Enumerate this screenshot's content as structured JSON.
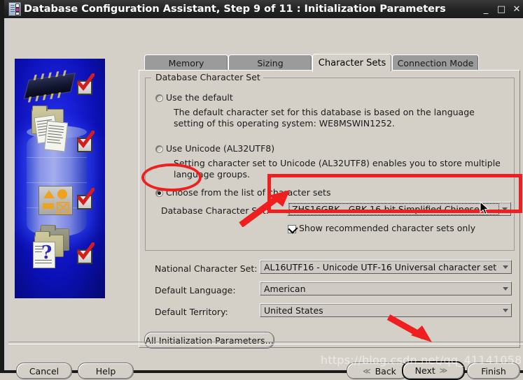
{
  "window": {
    "title": "Database Configuration Assistant, Step 9 of 11 : Initialization Parameters",
    "icon": "database-app-icon",
    "minimize_label": "_",
    "maximize_label": "□",
    "close_label": "✕"
  },
  "tabs": [
    {
      "id": "memory",
      "label": "Memory",
      "active": false
    },
    {
      "id": "sizing",
      "label": "Sizing",
      "active": false
    },
    {
      "id": "character-sets",
      "label": "Character Sets",
      "active": true
    },
    {
      "id": "connection-mode",
      "label": "Connection Mode",
      "active": false
    }
  ],
  "group": {
    "title": "Database Character Set",
    "options": [
      {
        "id": "use-default",
        "label": "Use the default",
        "selected": false,
        "description": "The default character set for this database is based on the language setting of this operating system: WE8MSWIN1252."
      },
      {
        "id": "use-unicode",
        "label": "Use Unicode (AL32UTF8)",
        "selected": false,
        "description": "Setting character set to Unicode (AL32UTF8) enables you to store multiple language groups."
      },
      {
        "id": "choose-from-list",
        "label": "Choose from the list of character sets",
        "selected": true,
        "description": ""
      }
    ],
    "database_charset_label": "Database Character Set:",
    "database_charset_value": "ZHS16GBK - GBK 16-bit Simplified Chinese",
    "show_recommended_label": "Show recommended character sets only",
    "show_recommended_checked": true
  },
  "fields": [
    {
      "id": "national-character-set",
      "label": "National Character Set:",
      "value": "AL16UTF16 - Unicode UTF-16 Universal character set"
    },
    {
      "id": "default-language",
      "label": "Default Language:",
      "value": "American"
    },
    {
      "id": "default-territory",
      "label": "Default Territory:",
      "value": "United States"
    }
  ],
  "buttons": {
    "all_init_params": "All Initialization Parameters...",
    "cancel": "Cancel",
    "help": "Help",
    "back": "Back",
    "next": "Next",
    "finish": "Finish",
    "back_arrow": "≪",
    "next_arrow": "≫"
  },
  "sidebar": {
    "alt": "Oracle Database Configuration Assistant wizard illustration",
    "steps_completed": 4
  },
  "annotations": {
    "ellipse_target": "choose-from-list-radio",
    "rect_target": "database-charset-combo",
    "arrow_to_combo": "red-arrow-up-right",
    "arrow_to_next": "red-arrow-down-right"
  },
  "watermark": {
    "text": "https://blog.csdn.net/qq_41141058"
  },
  "colors": {
    "annotation_red": "#ef1f1f",
    "window_chrome": "#1b1b1b",
    "panel_bg": "#d4d0c8",
    "tab_inactive": "#9b9b9b",
    "sidebar_blue": "#0b10b4"
  }
}
